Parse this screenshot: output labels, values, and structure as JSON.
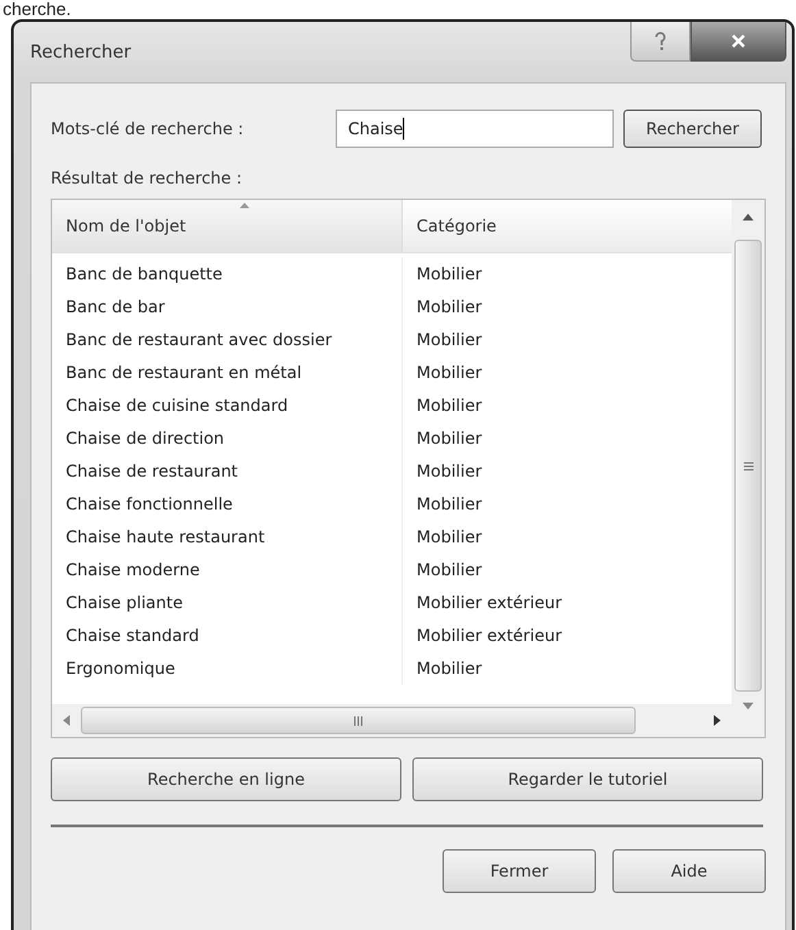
{
  "caption": "cherche.",
  "window": {
    "title": "Rechercher"
  },
  "search": {
    "label": "Mots-clé de recherche :",
    "value": "Chaise",
    "button": "Rechercher"
  },
  "results": {
    "label": "Résultat de recherche :",
    "columns": [
      {
        "label": "Nom de l'objet",
        "sorted": true
      },
      {
        "label": "Catégorie",
        "sorted": false
      }
    ],
    "rows": [
      {
        "name": "Banc de banquette",
        "category": "Mobilier"
      },
      {
        "name": "Banc de bar",
        "category": "Mobilier"
      },
      {
        "name": "Banc de restaurant avec dossier",
        "category": "Mobilier"
      },
      {
        "name": "Banc de restaurant en métal",
        "category": "Mobilier"
      },
      {
        "name": "Chaise de cuisine standard",
        "category": "Mobilier"
      },
      {
        "name": "Chaise de direction",
        "category": "Mobilier"
      },
      {
        "name": "Chaise de restaurant",
        "category": "Mobilier"
      },
      {
        "name": "Chaise fonctionnelle",
        "category": "Mobilier"
      },
      {
        "name": "Chaise haute restaurant",
        "category": "Mobilier"
      },
      {
        "name": "Chaise moderne",
        "category": "Mobilier"
      },
      {
        "name": "Chaise pliante",
        "category": "Mobilier extérieur"
      },
      {
        "name": "Chaise standard",
        "category": "Mobilier extérieur"
      },
      {
        "name": "Ergonomique",
        "category": "Mobilier"
      }
    ]
  },
  "action_buttons": [
    "Recherche en ligne",
    "Regarder le tutoriel"
  ],
  "footer_buttons": [
    "Fermer",
    "Aide"
  ]
}
